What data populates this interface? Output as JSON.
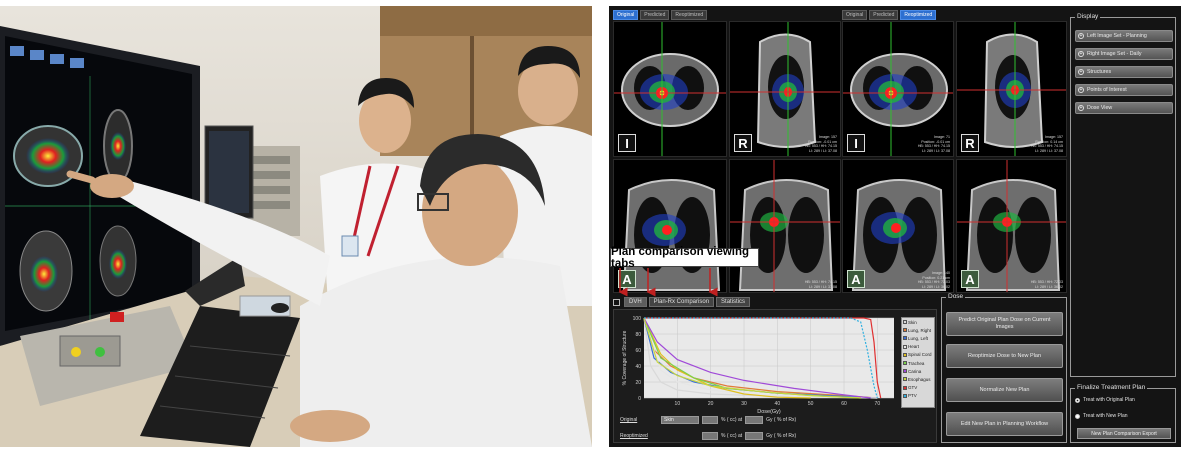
{
  "left_view": {
    "buttons": [
      {
        "label": "Original",
        "active": true
      },
      {
        "label": "Predicted",
        "active": false
      },
      {
        "label": "Reoptimized",
        "active": false
      }
    ],
    "axial": {
      "orientation": "I",
      "meta_lines": [
        "Image: 71",
        "Position: -0.01 cm",
        "HB: 553 / HH: 74.15",
        "LI: 289 / LI: 37.08"
      ]
    },
    "sagittal": {
      "orientation": "R",
      "meta_lines": [
        "Image: 157",
        "Position: -0.01 cm",
        "HB: 553 / HH: 74.15",
        "LI: 289 / LI: 37.08"
      ]
    },
    "coronal": {
      "orientation": "A",
      "meta_lines": []
    },
    "coronal2": {
      "orientation": "",
      "meta_lines": [
        "HB: 553 / HH: 74.15",
        "LI: 289 / LI: 37.08"
      ]
    }
  },
  "right_view": {
    "buttons": [
      {
        "label": "Original",
        "active": false
      },
      {
        "label": "Predicted",
        "active": false
      },
      {
        "label": "Reoptimized",
        "active": true
      }
    ],
    "axial": {
      "orientation": "I",
      "meta_lines": [
        "Image: 71",
        "Position: -0.01 cm",
        "HB: 553 / HH: 74.15",
        "LI: 289 / LI: 37.08"
      ]
    },
    "sagittal": {
      "orientation": "R",
      "meta_lines": [
        "Image: 157",
        "Position: 0.14 cm",
        "HB: 553 / HH: 74.15",
        "LI: 289 / LI: 37.08"
      ]
    },
    "coronal": {
      "orientation": "A",
      "meta_lines": [
        "Image: 140",
        "Position: 0.21 cm",
        "HB: 553 / HH: 72.03",
        "LI: 289 / LI: 36.02"
      ]
    },
    "coronal2": {
      "orientation": "A",
      "meta_lines": [
        "HB: 553 / HH: 72.03",
        "LI: 289 / LI: 36.02"
      ]
    }
  },
  "display_panel": {
    "title": "Display",
    "buttons": [
      "Left Image Set - Planning",
      "Right Image Set - Daily",
      "Structures",
      "Points of Interest",
      "Dose View"
    ]
  },
  "dose_panel": {
    "title": "Dose",
    "buttons": [
      "Predict Original Plan Dose on Current Images",
      "Reoptimize Dose to New Plan",
      "Normalize New Plan",
      "Edit New Plan in Planning Workflow"
    ]
  },
  "finalize_panel": {
    "title": "Finalize Treatment Plan",
    "options": [
      {
        "label": "Treat with Original Plan",
        "selected": true
      },
      {
        "label": "Treat with New Plan",
        "selected": false
      }
    ],
    "export_label": "New Plan Comparison Export"
  },
  "tabs": [
    {
      "label": "DVH",
      "active": true
    },
    {
      "label": "Plan-Rx Comparison",
      "active": false
    },
    {
      "label": "Statistics",
      "active": false
    }
  ],
  "annotation": "Plan comparison viewing tabs",
  "dose_rows": [
    {
      "label": "Original",
      "structure": "Skin",
      "cc_unit": "% (  cc) at",
      "gy_unit": "Gy  ( % of Rx)"
    },
    {
      "label": "Reoptimized",
      "structure": "",
      "cc_unit": "% (  cc) at",
      "gy_unit": "Gy  ( % of Rx)"
    }
  ],
  "chart_data": {
    "type": "line",
    "title": "",
    "xlabel": "Dose(Gy)",
    "ylabel": "% Coverage of Structure",
    "xlim": [
      0,
      75
    ],
    "ylim": [
      0,
      100
    ],
    "x_ticks": [
      10,
      20,
      30,
      40,
      50,
      60,
      70
    ],
    "y_ticks": [
      0,
      20,
      40,
      60,
      80,
      100
    ],
    "grid": true,
    "legend_position": "right",
    "series": [
      {
        "name": "Skin",
        "color": "#d9d9d9",
        "x": [
          0,
          2,
          5,
          10,
          20,
          40,
          70
        ],
        "y": [
          100,
          40,
          20,
          10,
          5,
          2,
          0
        ]
      },
      {
        "name": "Lung, Right",
        "color": "#e07b39",
        "x": [
          0,
          3,
          8,
          15,
          25,
          40,
          60,
          70
        ],
        "y": [
          100,
          60,
          40,
          25,
          15,
          8,
          3,
          0
        ]
      },
      {
        "name": "Lung, Left",
        "color": "#3a6fd8",
        "x": [
          0,
          3,
          8,
          15,
          25,
          40,
          60,
          70
        ],
        "y": [
          100,
          50,
          32,
          20,
          12,
          6,
          2,
          0
        ]
      },
      {
        "name": "Heart",
        "color": "#e6e6e6",
        "x": [
          0,
          5,
          10,
          20,
          30,
          45,
          70
        ],
        "y": [
          100,
          35,
          20,
          10,
          5,
          2,
          0
        ]
      },
      {
        "name": "Spinal Cord",
        "color": "#e0c020",
        "x": [
          0,
          5,
          10,
          20,
          30,
          40,
          50
        ],
        "y": [
          100,
          55,
          35,
          15,
          5,
          1,
          0
        ]
      },
      {
        "name": "Trachea",
        "color": "#7ad14a",
        "x": [
          0,
          5,
          15,
          25,
          40,
          55,
          65
        ],
        "y": [
          100,
          50,
          25,
          12,
          6,
          2,
          0
        ]
      },
      {
        "name": "Carina",
        "color": "#a04ad8",
        "x": [
          0,
          4,
          10,
          20,
          30,
          45,
          60,
          68
        ],
        "y": [
          100,
          70,
          48,
          32,
          22,
          12,
          4,
          0
        ]
      },
      {
        "name": "Esophagus",
        "color": "#c8d640",
        "x": [
          0,
          4,
          10,
          20,
          35,
          50,
          65
        ],
        "y": [
          100,
          45,
          28,
          15,
          8,
          3,
          0
        ]
      },
      {
        "name": "GTV",
        "color": "#e03030",
        "x": [
          0,
          66,
          68,
          69,
          70,
          71
        ],
        "y": [
          100,
          100,
          98,
          70,
          20,
          0
        ]
      },
      {
        "name": "PTV",
        "color": "#30b0e0",
        "x": [
          0,
          62,
          65,
          67,
          69,
          70
        ],
        "y": [
          100,
          100,
          95,
          60,
          15,
          0
        ]
      }
    ]
  }
}
